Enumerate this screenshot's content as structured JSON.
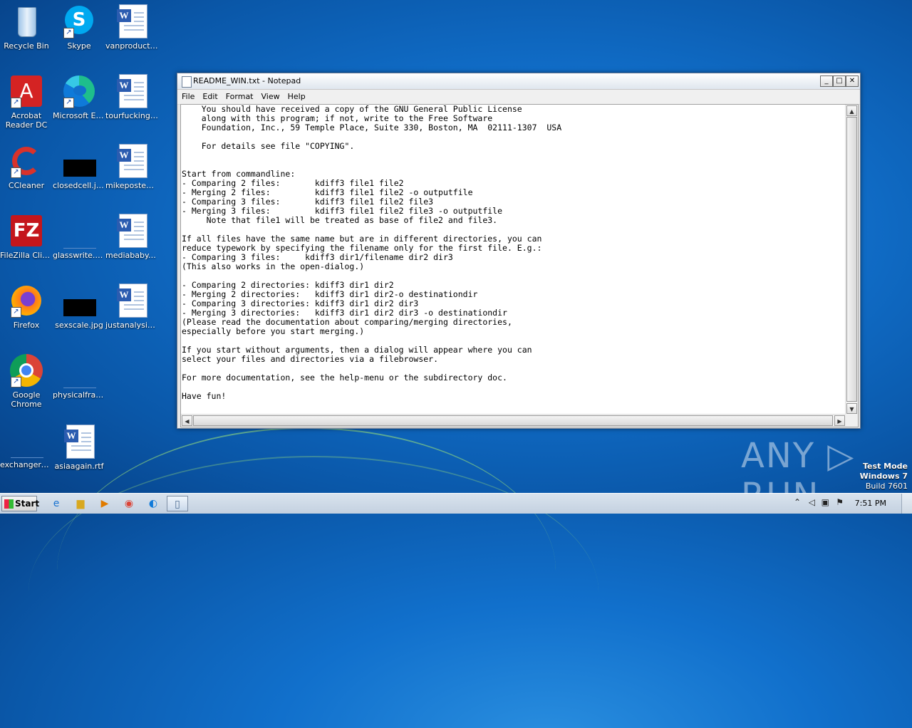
{
  "desktop": {
    "icons": [
      {
        "label": "Recycle Bin",
        "icon": "recycle-bin-icon"
      },
      {
        "label": "Skype",
        "icon": "skype-icon"
      },
      {
        "label": "vanproduct....",
        "icon": "word-document-icon"
      },
      {
        "label": "Acrobat Reader DC",
        "icon": "acrobat-icon"
      },
      {
        "label": "Microsoft Edge",
        "icon": "edge-icon"
      },
      {
        "label": "tourfucking.rtf",
        "icon": "word-document-icon"
      },
      {
        "label": "CCleaner",
        "icon": "ccleaner-icon"
      },
      {
        "label": "closedcell.jpg",
        "icon": "image-thumbnail-icon"
      },
      {
        "label": "mikeposted.rtf",
        "icon": "word-document-icon"
      },
      {
        "label": "FileZilla Client",
        "icon": "filezilla-icon"
      },
      {
        "label": "glasswrite.png",
        "icon": "image-thumbnail-icon"
      },
      {
        "label": "mediababy.rtf",
        "icon": "word-document-icon"
      },
      {
        "label": "Firefox",
        "icon": "firefox-icon"
      },
      {
        "label": "sexscale.jpg",
        "icon": "image-thumbnail-icon"
      },
      {
        "label": "justanalysis....",
        "icon": "word-document-icon"
      },
      {
        "label": "Google Chrome",
        "icon": "chrome-icon"
      },
      {
        "label": "physicalfran...",
        "icon": "image-thumbnail-icon"
      },
      {
        "label": "exchangere...",
        "icon": "image-thumbnail-icon"
      },
      {
        "label": "asiaagain.rtf",
        "icon": "word-document-icon"
      }
    ]
  },
  "notepad": {
    "title": "README_WIN.txt - Notepad",
    "menu": [
      "File",
      "Edit",
      "Format",
      "View",
      "Help"
    ],
    "content": "    You should have received a copy of the GNU General Public License\n    along with this program; if not, write to the Free Software\n    Foundation, Inc., 59 Temple Place, Suite 330, Boston, MA  02111-1307  USA\n\n    For details see file \"COPYING\".\n\n\nStart from commandline:\n- Comparing 2 files:       kdiff3 file1 file2\n- Merging 2 files:         kdiff3 file1 file2 -o outputfile\n- Comparing 3 files:       kdiff3 file1 file2 file3\n- Merging 3 files:         kdiff3 file1 file2 file3 -o outputfile\n     Note that file1 will be treated as base of file2 and file3.\n\nIf all files have the same name but are in different directories, you can\nreduce typework by specifying the filename only for the first file. E.g.:\n- Comparing 3 files:     kdiff3 dir1/filename dir2 dir3\n(This also works in the open-dialog.)\n\n- Comparing 2 directories: kdiff3 dir1 dir2\n- Merging 2 directories:   kdiff3 dir1 dir2-o destinationdir\n- Comparing 3 directories: kdiff3 dir1 dir2 dir3\n- Merging 3 directories:   kdiff3 dir1 dir2 dir3 -o destinationdir\n(Please read the documentation about comparing/merging directories,\nespecially before you start merging.)\n\nIf you start without arguments, then a dialog will appear where you can\nselect your files and directories via a filebrowser.\n\nFor more documentation, see the help-menu or the subdirectory doc.\n\nHave fun!",
    "buttons": {
      "minimize": "_",
      "maximize": "□",
      "close": "✕"
    }
  },
  "watermark": "ANY ▷ RUN",
  "system": {
    "line1": "Test Mode",
    "line2": "Windows 7",
    "line3": "Build 7601"
  },
  "taskbar": {
    "start_label": "Start",
    "pinned": [
      "internet-explorer-icon",
      "explorer-icon",
      "media-player-icon",
      "chrome-icon",
      "edge-icon",
      "notepad-icon"
    ],
    "clock": "7:51 PM"
  }
}
